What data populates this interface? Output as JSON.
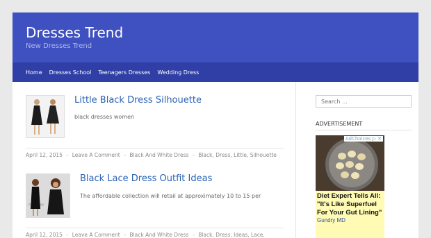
{
  "site": {
    "title": "Dresses Trend",
    "description": "New Dresses Trend"
  },
  "nav": [
    "Home",
    "Dresses School",
    "Teenagers Dresses",
    "Wedding Dress"
  ],
  "posts": [
    {
      "title": "Little Black Dress Silhouette",
      "excerpt": "black dresses women",
      "date": "April 12, 2015",
      "comments": "Leave A Comment",
      "category": "Black And White Dress",
      "tags": "Black, Dress, Little, Silhouette"
    },
    {
      "title": "Black Lace Dress Outfit Ideas",
      "excerpt": "The affordable collection will retail at approximately 10 to 15 per",
      "date": "April 12, 2015",
      "comments": "Leave A Comment",
      "category": "Black And White Dress",
      "tags": "Black, Dress, Ideas, Lace,"
    }
  ],
  "sidebar": {
    "search_placeholder": "Search …",
    "ad_heading": "ADVERTISEMENT",
    "ad_headline": "Diet Expert Tells All: \"It's Like Superfuel For Your Gut Lining\"",
    "ad_source": "Gundry MD",
    "ad_choices": "AdChoices ▷ ✕"
  },
  "colors": {
    "header": "#3f51c1",
    "nav": "#2f3fa6",
    "link": "#2a62b6",
    "ad_bg": "#fffbb4"
  }
}
